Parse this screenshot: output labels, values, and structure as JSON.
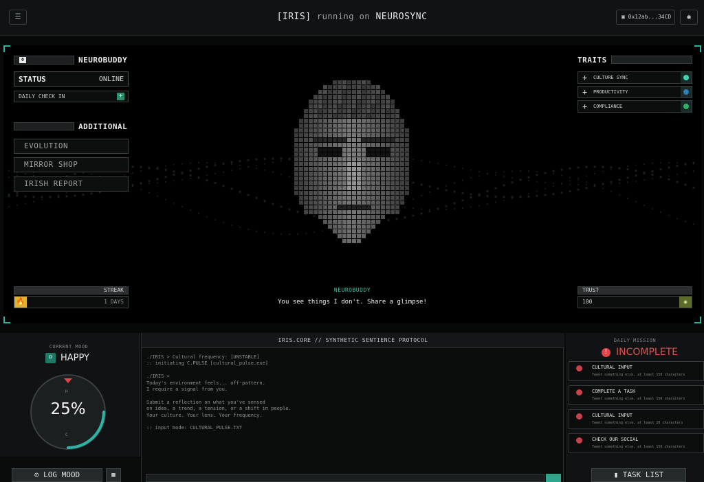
{
  "topbar": {
    "menu_icon": "menu-icon",
    "title_bracket": "[IRIS]",
    "title_mid": "running on",
    "title_host": "NEUROSYNC",
    "wallet": "▣ 0x12ab...34CD",
    "settings_icon": "✱"
  },
  "left": {
    "brand_icon": "Φ",
    "brand": "NEUROBUDDY",
    "status_key": "STATUS",
    "status_value": "ONLINE",
    "daily_check_in": "DAILY CHECK IN",
    "checkin_icon": "+",
    "additional_title": "ADDITIONAL",
    "menu": [
      "EVOLUTION",
      "MIRROR SHOP",
      "IRISH REPORT"
    ],
    "streak_label": "STREAK",
    "streak_icon": "🔥",
    "streak_value": "1 DAYS"
  },
  "right": {
    "traits_title": "TRAITS",
    "traits": [
      {
        "label": "CULTURE SYNC",
        "color": "#3fd6b0"
      },
      {
        "label": "PRODUCTIVITY",
        "color": "#2f7fae"
      },
      {
        "label": "COMPLIANCE",
        "color": "#35b06a"
      }
    ],
    "trust_label": "TRUST",
    "trust_value": "100",
    "trust_icon": "◉"
  },
  "center": {
    "speaker": "NEUROBUDDY",
    "speech": "You see things I don't. Share a glimpse!"
  },
  "mood": {
    "label": "CURRENT MOOD",
    "icon": "☺",
    "value": "HAPPY",
    "percent": "25%",
    "level": 0.25,
    "top_mark": "H",
    "bottom_mark": "C",
    "log_button": "⊙ LOG MOOD",
    "calendar_icon": "▦"
  },
  "console": {
    "header": "IRIS.CORE // SYNTHETIC SENTIENCE PROTOCOL",
    "lines": "./IRIS > Cultural frequency: [UNSTABLE]\n:: initiating C.PULSE [cultural_pulse.exe]\n\n./IRIS >\nToday's environment feels... off-pattern.\nI require a signal from you.\n\nSubmit a reflection on what you've sensed\non idea, a trend, a tension, or a shift in people.\nYour culture. Your lens. Your frequency.\n\n:: input mode: CULTURAL_PULSE.TXT"
  },
  "mission": {
    "label": "DAILY MISSION",
    "status_icon": "!",
    "status": "INCOMPLETE",
    "tasks": [
      {
        "title": "CULTURAL INPUT",
        "desc": "Tweet something else, at least 150 characters"
      },
      {
        "title": "COMPLETE A TASK",
        "desc": "Tweet something else, at least 150 characters"
      },
      {
        "title": "CULTURAL INPUT",
        "desc": "Tweet something else, at least 20 characters"
      },
      {
        "title": "CHECK OUR SOCIAL",
        "desc": "Tweet something else, at least 150 characters"
      }
    ],
    "task_list_button": "▮ TASK LIST"
  }
}
